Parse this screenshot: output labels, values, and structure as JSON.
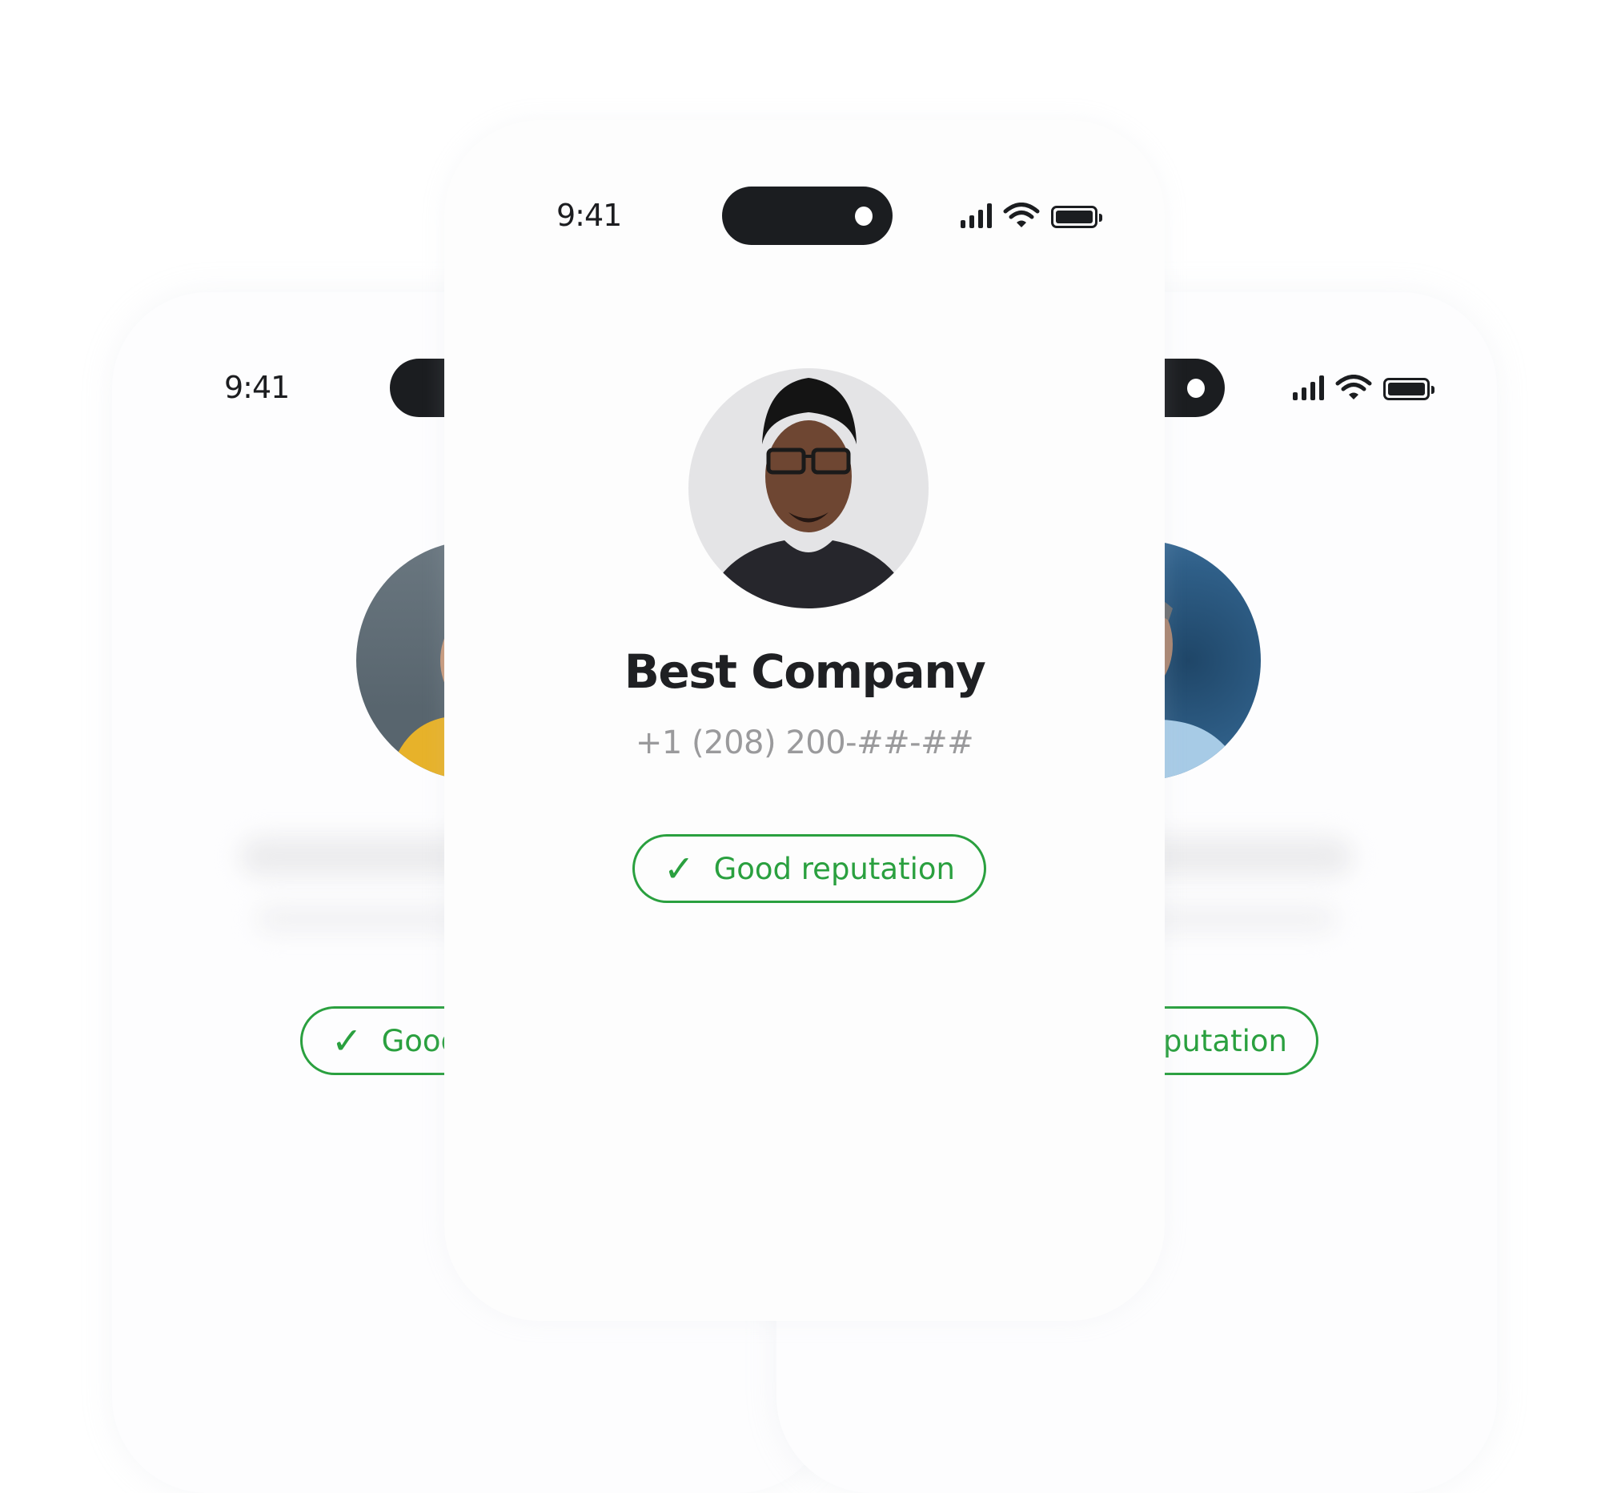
{
  "status_bar": {
    "time": "9:41",
    "icons": [
      "signal-icon",
      "wifi-icon",
      "battery-icon"
    ]
  },
  "phones": [
    {
      "position": "left-back",
      "avatar": "person-yellow-shirt-photo",
      "badge": {
        "icon": "✓",
        "label": "Good reputation"
      }
    },
    {
      "position": "front",
      "avatar": "man-glasses-photo",
      "company_name": "Best Company",
      "phone_number": "+1 (208) 200-##-##",
      "badge": {
        "icon": "✓",
        "label": "Good reputation"
      }
    },
    {
      "position": "right-back",
      "avatar": "man-blue-shirt-photo",
      "badge": {
        "icon": "✓",
        "label": "Good reputation"
      }
    }
  ],
  "colors": {
    "accent": "#2aa03f",
    "text": "#1f2023",
    "muted": "#9a9a9c",
    "island": "#1b1d20"
  }
}
